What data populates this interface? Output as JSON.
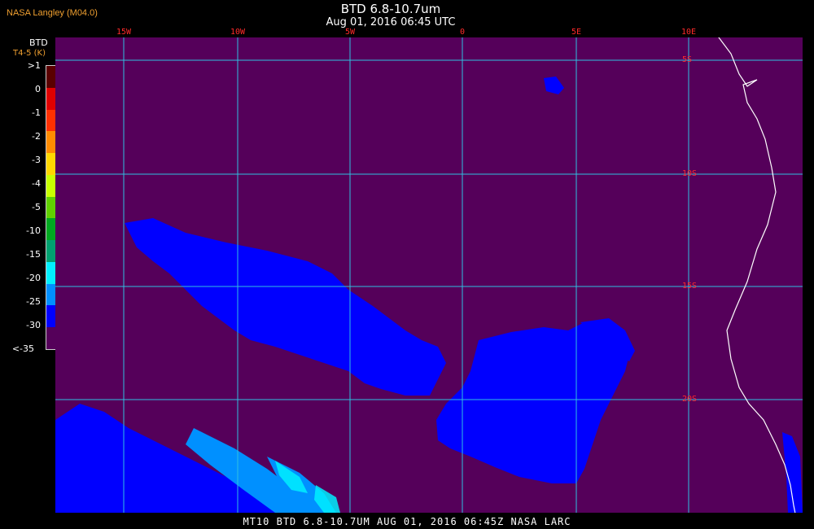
{
  "credit": "NASA Langley (M04.0)",
  "title": "BTD 6.8-10.7um",
  "subtitle": "Aug 01, 2016 06:45 UTC",
  "legend": {
    "title": "BTD",
    "units": "T4-5 (K)",
    "entries": [
      {
        "label": ">1",
        "color": "#5a0000"
      },
      {
        "label": "0",
        "color": "#e00000"
      },
      {
        "label": "-1",
        "color": "#ff3000"
      },
      {
        "label": "-2",
        "color": "#ff8c00"
      },
      {
        "label": "-3",
        "color": "#ffd800"
      },
      {
        "label": "-4",
        "color": "#c8ff00"
      },
      {
        "label": "-5",
        "color": "#60d000"
      },
      {
        "label": "-10",
        "color": "#00a820"
      },
      {
        "label": "-15",
        "color": "#00a070"
      },
      {
        "label": "-20",
        "color": "#00f0ff"
      },
      {
        "label": "-25",
        "color": "#0090ff"
      },
      {
        "label": "-30",
        "color": "#0000ff"
      },
      {
        "label": "<-35",
        "color": "#55005a"
      }
    ]
  },
  "map": {
    "background_color": "#55005a",
    "grid_color": "#30c0e0",
    "coast_color": "#ffffff",
    "longitude_labels": [
      "15W",
      "10W",
      "5W",
      "0",
      "5E",
      "10E"
    ],
    "latitude_labels": [
      "5S",
      "10S",
      "15S",
      "20S"
    ]
  },
  "footer": "MT10  BTD 6.8-10.7UM   AUG 01, 2016 06:45Z   NASA LARC"
}
